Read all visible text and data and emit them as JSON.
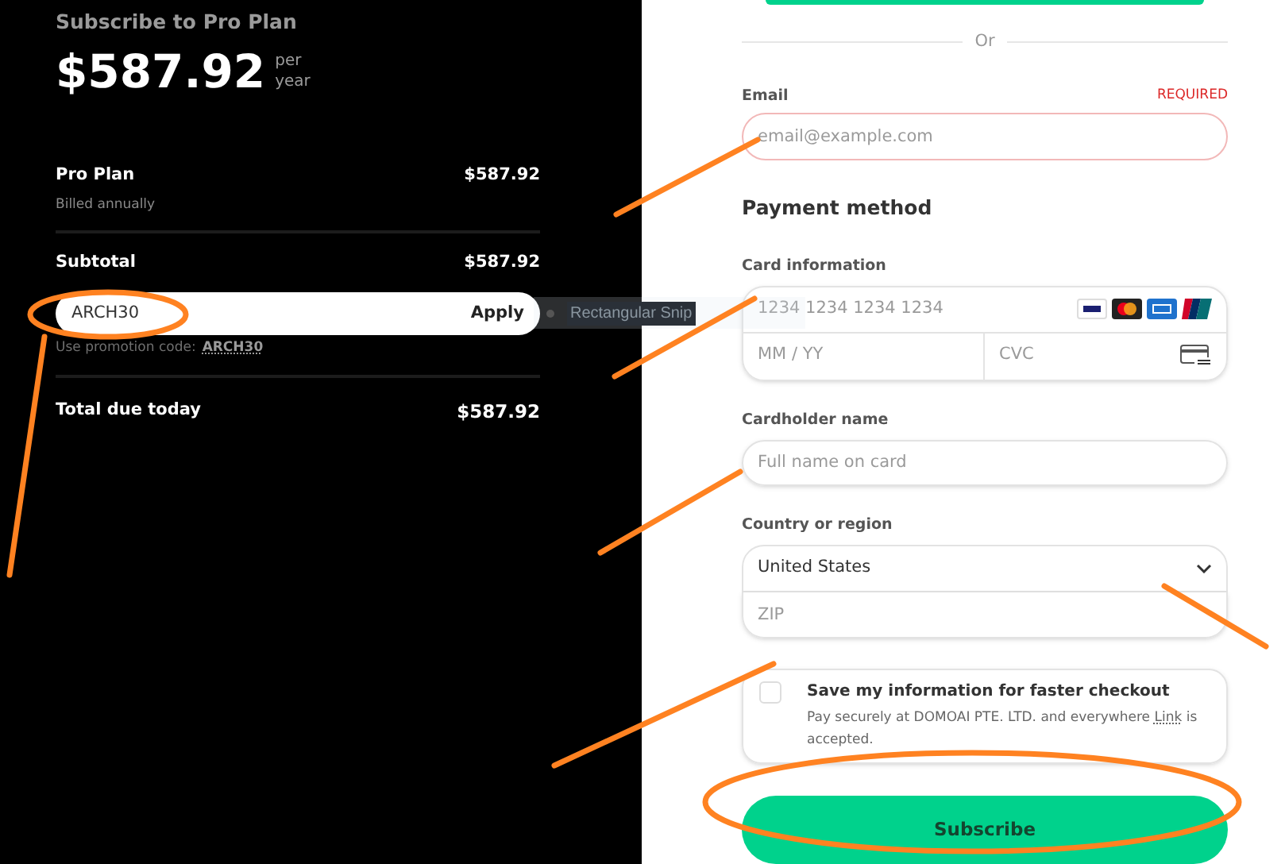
{
  "summary": {
    "title": "Subscribe to Pro Plan",
    "price": "$587.92",
    "period": [
      "per",
      "year"
    ],
    "line_items": [
      {
        "label": "Pro Plan",
        "sublabel": "Billed annually",
        "amount": "$587.92"
      }
    ],
    "subtotal": {
      "label": "Subtotal",
      "amount": "$587.92"
    },
    "promo": {
      "value": "ARCH30",
      "button": "Apply",
      "hint": "Use promotion code:",
      "code": "ARCH30"
    },
    "total": {
      "label": "Total due today",
      "amount": "$587.92"
    }
  },
  "tooltip": {
    "text": "Rectangular Snip"
  },
  "checkout": {
    "divider": "Or",
    "email": {
      "label": "Email",
      "required": "REQUIRED",
      "placeholder": "email@example.com"
    },
    "payment_heading": "Payment method",
    "card": {
      "label": "Card information",
      "number_placeholder": "1234 1234 1234 1234",
      "expiry_placeholder": "MM / YY",
      "cvc_placeholder": "CVC"
    },
    "cardholder": {
      "label": "Cardholder name",
      "placeholder": "Full name on card"
    },
    "country": {
      "label": "Country or region",
      "value": "United States",
      "zip_placeholder": "ZIP"
    },
    "save": {
      "checked": false,
      "title": "Save my information for faster checkout",
      "text": "Pay securely at DOMOAI PTE. LTD. and everywhere",
      "link": "Link",
      "text_end": "is accepted."
    },
    "subscribe_button": "Subscribe"
  }
}
